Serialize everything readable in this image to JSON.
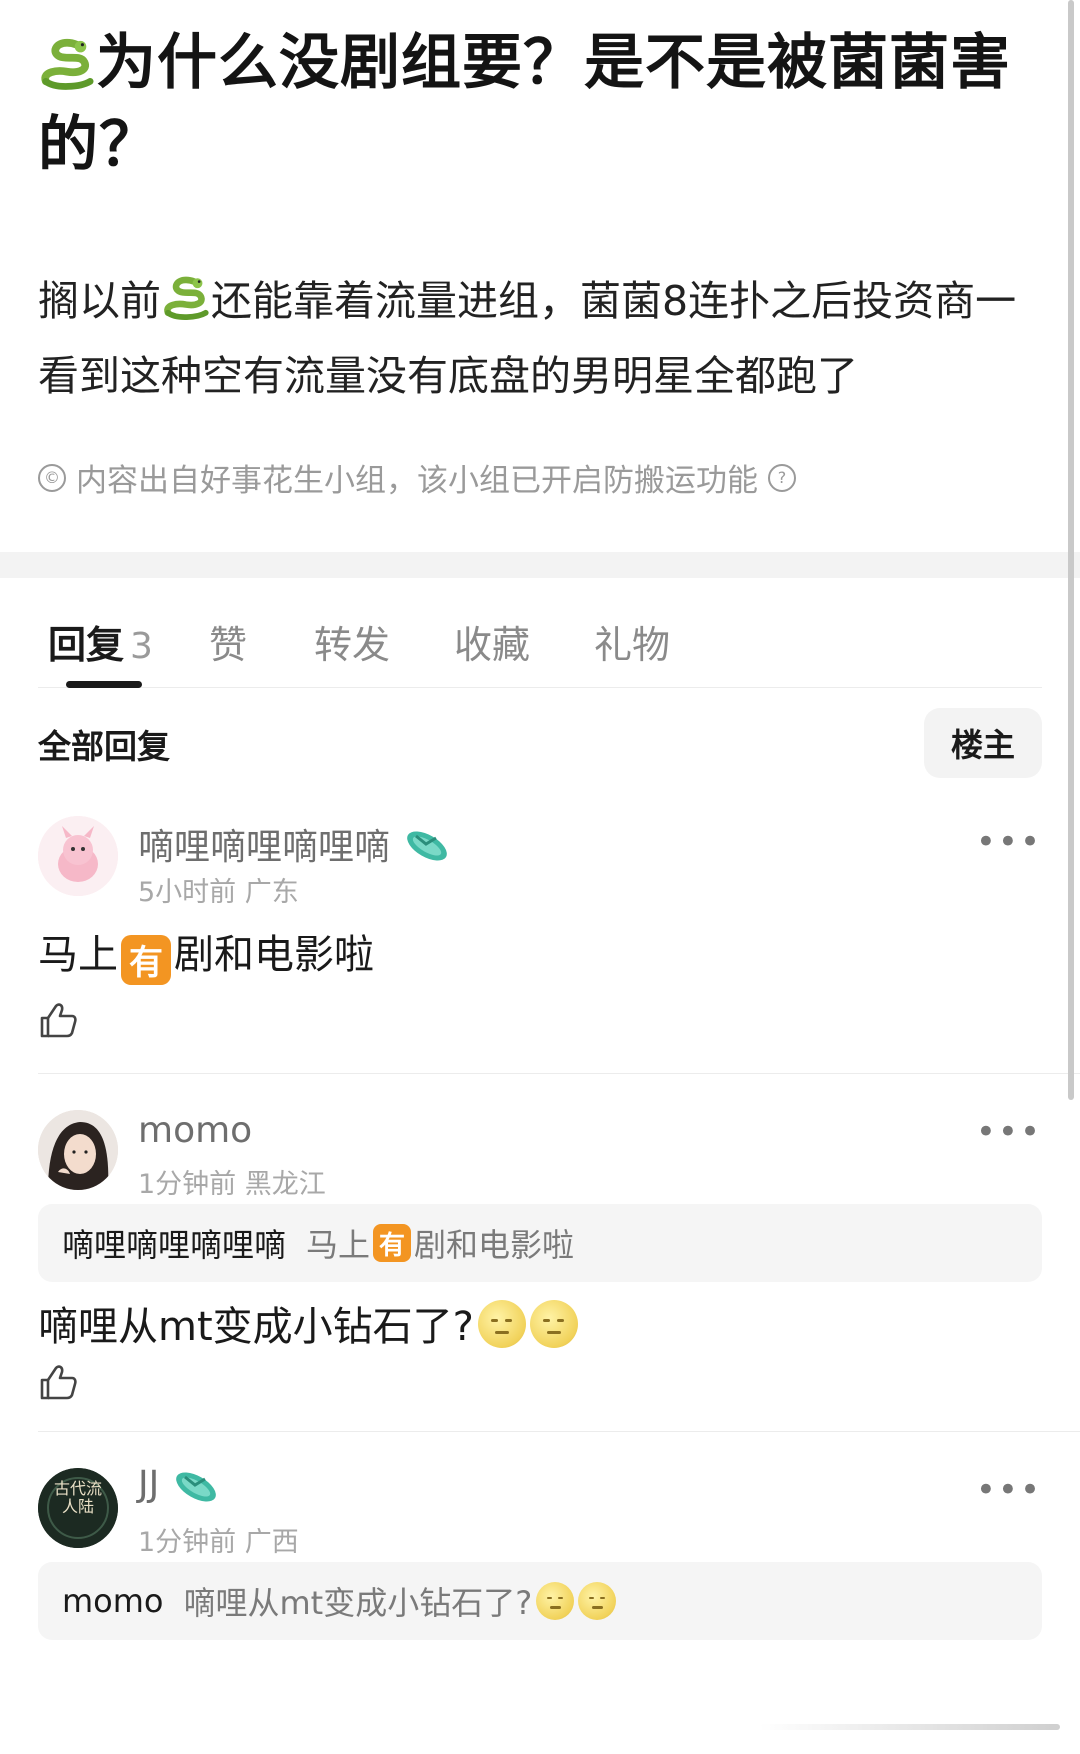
{
  "post": {
    "title_text": "为什么没剧组要？是不是被菌菌害的？",
    "title_icon": "snake-icon",
    "body_part1": "搁以前",
    "body_part2": "还能靠着流量进组，菌菌8连扑之后投资商一看到这种空有流量没有底盘的男明星全都跑了",
    "source_note": "内容出自好事花生小组，该小组已开启防搬运功能"
  },
  "tabs": [
    {
      "label": "回复",
      "count": "3"
    },
    {
      "label": "赞"
    },
    {
      "label": "转发"
    },
    {
      "label": "收藏"
    },
    {
      "label": "礼物"
    }
  ],
  "replies_header": {
    "title": "全部回复",
    "filter_button": "楼主"
  },
  "comments": [
    {
      "username": "嘀哩嘀哩嘀哩嘀",
      "badge_icon": "flip-flop-icon",
      "meta": "5小时前 广东",
      "text_before": "马上",
      "badge_char": "有",
      "text_after": "剧和电影啦"
    },
    {
      "username": "momo",
      "meta": "1分钟前 黑龙江",
      "quote_name": "嘀哩嘀哩嘀哩嘀",
      "quote_before": "马上",
      "quote_badge": "有",
      "quote_after": "剧和电影啦",
      "text": "嘀哩从mt变成小钻石了?"
    },
    {
      "username": "JJ",
      "badge_icon": "flip-flop-icon",
      "meta": "1分钟前 广西",
      "avatar_text": "古代流人陆",
      "quote_name": "momo",
      "quote_text": "嘀哩从mt变成小钻石了?"
    }
  ],
  "colors": {
    "accent_badge": "#f39522",
    "muted_text": "#9a9a9a",
    "quote_bg": "#f5f5f5"
  }
}
